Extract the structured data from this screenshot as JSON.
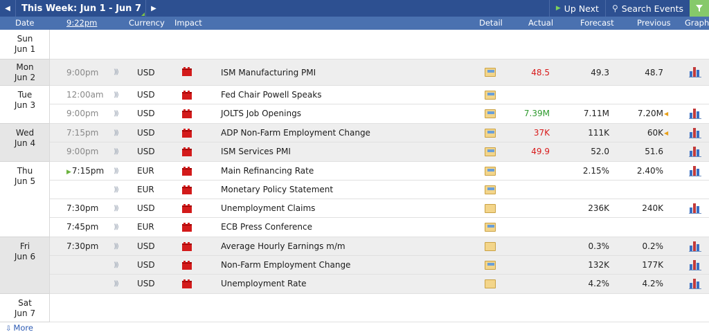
{
  "toolbar": {
    "prev_label": "◀",
    "week_label": "This Week: Jun 1 - Jun 7",
    "next_label": "▶",
    "up_next_label": "Up Next",
    "search_label": "Search Events",
    "filter_icon": "filter-icon"
  },
  "header": {
    "date": "Date",
    "time": "9:22pm",
    "currency": "Currency",
    "impact": "Impact",
    "detail": "Detail",
    "actual": "Actual",
    "forecast": "Forecast",
    "previous": "Previous",
    "graph": "Graph"
  },
  "days": [
    {
      "line1": "Sun",
      "line2": "Jun 1"
    },
    {
      "line1": "Mon",
      "line2": "Jun 2"
    },
    {
      "line1": "Tue",
      "line2": "Jun 3"
    },
    {
      "line1": "Wed",
      "line2": "Jun 4"
    },
    {
      "line1": "Thu",
      "line2": "Jun 5"
    },
    {
      "line1": "Fri",
      "line2": "Jun 6"
    },
    {
      "line1": "Sat",
      "line2": "Jun 7"
    }
  ],
  "events": [
    {
      "time": "9:00pm",
      "currency": "USD",
      "event": "ISM Manufacturing PMI",
      "actual": "48.5",
      "actual_status": "red",
      "forecast": "49.3",
      "previous": "48.7"
    },
    {
      "time": "12:00am",
      "currency": "USD",
      "event": "Fed Chair Powell Speaks",
      "actual": "",
      "forecast": "",
      "previous": ""
    },
    {
      "time": "9:00pm",
      "currency": "USD",
      "event": "JOLTS Job Openings",
      "actual": "7.39M",
      "actual_status": "green",
      "forecast": "7.11M",
      "previous": "7.20M"
    },
    {
      "time": "7:15pm",
      "currency": "USD",
      "event": "ADP Non-Farm Employment Change",
      "actual": "37K",
      "actual_status": "red",
      "forecast": "111K",
      "previous": "60K"
    },
    {
      "time": "9:00pm",
      "currency": "USD",
      "event": "ISM Services PMI",
      "actual": "49.9",
      "actual_status": "red",
      "forecast": "52.0",
      "previous": "51.6"
    },
    {
      "time": "7:15pm",
      "currency": "EUR",
      "event": "Main Refinancing Rate",
      "actual": "",
      "forecast": "2.15%",
      "previous": "2.40%"
    },
    {
      "time": "",
      "currency": "EUR",
      "event": "Monetary Policy Statement",
      "actual": "",
      "forecast": "",
      "previous": ""
    },
    {
      "time": "7:30pm",
      "currency": "USD",
      "event": "Unemployment Claims",
      "actual": "",
      "forecast": "236K",
      "previous": "240K"
    },
    {
      "time": "7:45pm",
      "currency": "EUR",
      "event": "ECB Press Conference",
      "actual": "",
      "forecast": "",
      "previous": ""
    },
    {
      "time": "7:30pm",
      "currency": "USD",
      "event": "Average Hourly Earnings m/m",
      "actual": "",
      "forecast": "0.3%",
      "previous": "0.2%"
    },
    {
      "time": "",
      "currency": "USD",
      "event": "Non-Farm Employment Change",
      "actual": "",
      "forecast": "132K",
      "previous": "177K"
    },
    {
      "time": "",
      "currency": "USD",
      "event": "Unemployment Rate",
      "actual": "",
      "forecast": "4.2%",
      "previous": "4.2%"
    }
  ],
  "footer": {
    "more_label": "More"
  },
  "colors": {
    "header_bg": "#2d5091",
    "column_header_bg": "#4a71b0",
    "actual_worse": "#d81b1b",
    "actual_better": "#2e9a2e",
    "high_impact": "#d31b1b",
    "filter_bg": "#86c96a"
  }
}
